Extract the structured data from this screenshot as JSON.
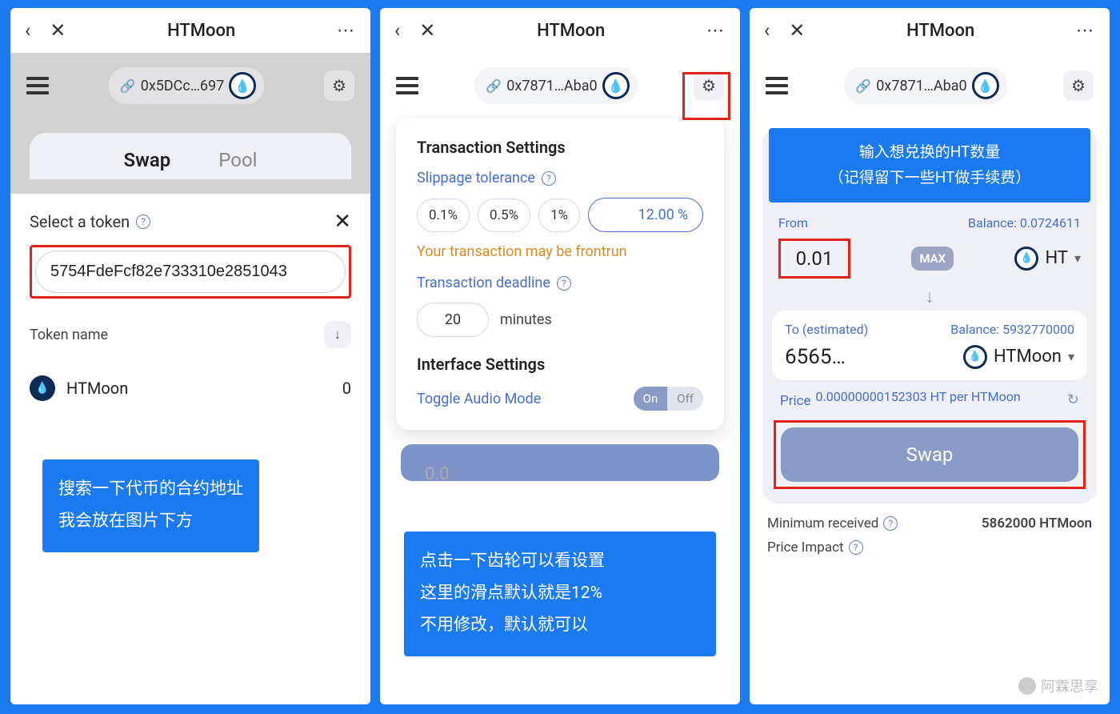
{
  "common": {
    "title": "HTMoon",
    "link_icon": "🔗",
    "gear_icon": "⚙",
    "menu_icon": "≡"
  },
  "panel1": {
    "address": "0x5DCc…697",
    "tab_swap": "Swap",
    "tab_pool": "Pool",
    "sheet_title": "Select a token",
    "search_value": "5754FdeFcf82e733310e2851043",
    "token_name_label": "Token name",
    "token_result_name": "HTMoon",
    "token_result_balance": "0",
    "callout_line1": "搜索一下代币的合约地址",
    "callout_line2": "我会放在图片下方"
  },
  "panel2": {
    "address": "0x7871…Aba0",
    "settings_title": "Transaction Settings",
    "slippage_label": "Slippage tolerance",
    "slip_opts": [
      "0.1%",
      "0.5%",
      "1%"
    ],
    "slip_custom": "12.00",
    "slip_pct": "%",
    "warn": "Your transaction may be frontrun",
    "deadline_label": "Transaction deadline",
    "deadline_value": "20",
    "deadline_unit": "minutes",
    "interface_title": "Interface Settings",
    "toggle_label": "Toggle Audio Mode",
    "toggle_on": "On",
    "toggle_off": "Off",
    "peek_amount": "0.0",
    "callout_line1": "点击一下齿轮可以看设置",
    "callout_line2": "这里的滑点默认就是12%",
    "callout_line3": "不用修改，默认就可以"
  },
  "panel3": {
    "address": "0x7871…Aba0",
    "banner_line1": "输入想兑换的HT数量",
    "banner_line2": "（记得留下一些HT做手续费）",
    "from_label": "From",
    "from_balance_label": "Balance: 0.0724611",
    "from_amount": "0.01",
    "max_label": "MAX",
    "from_token": "HT",
    "to_label": "To (estimated)",
    "to_balance_label": "Balance: 5932770000",
    "to_amount": "6565…",
    "to_token": "HTMoon",
    "price_label": "Price",
    "price_value": "0.00000000152303 HT per HTMoon",
    "swap_label": "Swap",
    "min_recv_label": "Minimum received",
    "min_recv_value": "5862000 HTMoon",
    "price_impact_label": "Price Impact",
    "watermark": "阿霖思享"
  }
}
